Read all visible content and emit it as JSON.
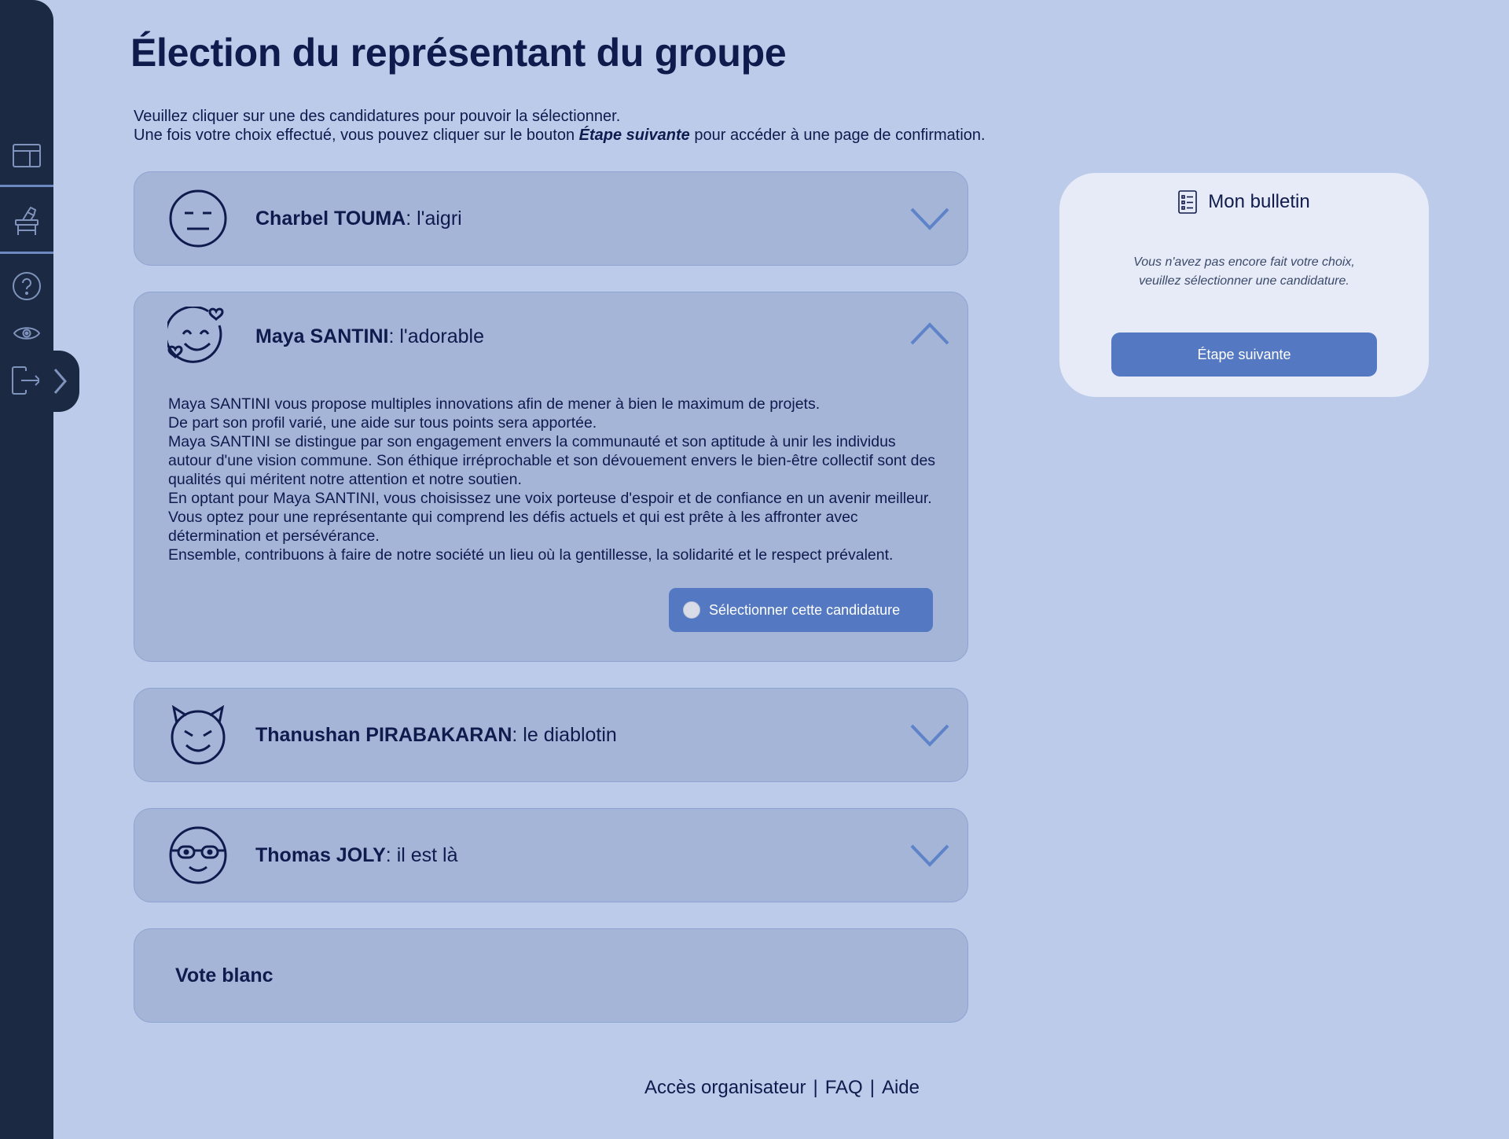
{
  "page": {
    "title": "Élection du représentant du groupe",
    "intro_line1": "Veuillez cliquer sur une des candidatures pour pouvoir la sélectionner.",
    "intro_line2_before": "Une fois votre choix effectué, vous pouvez cliquer sur le bouton ",
    "intro_line2_emphasis": "Étape suivante",
    "intro_line2_after": " pour accéder à une page de confirmation."
  },
  "sidebar": {
    "icons": [
      "layout-icon",
      "ballot-box-icon",
      "help-icon",
      "eye-icon",
      "logout-icon"
    ],
    "expand_icon": "chevron-right-icon"
  },
  "candidates": [
    {
      "name": "Charbel TOUMA",
      "tagline": " : l'aigri",
      "avatar": "neutral-face-icon",
      "expanded": false
    },
    {
      "name": "Maya SANTINI",
      "tagline": " : l'adorable",
      "avatar": "heart-smile-face-icon",
      "expanded": true,
      "description": [
        "Maya SANTINI vous propose multiples innovations afin de mener à bien le maximum de projets.",
        "De part son profil varié, une aide sur tous points sera apportée.",
        "Maya SANTINI se distingue par son engagement envers la communauté et son aptitude à unir les individus autour d'une vision commune. Son éthique irréprochable et son dévouement envers le bien-être collectif sont des qualités qui méritent notre attention et notre soutien.",
        "En optant pour Maya SANTINI, vous choisissez une voix porteuse d'espoir et de confiance en un avenir meilleur. Vous optez pour une représentante qui comprend les défis actuels et qui est prête à les affronter avec détermination et persévérance.",
        "Ensemble, contribuons à faire de notre société un lieu où la gentillesse, la solidarité et le respect prévalent."
      ],
      "select_label": "Sélectionner cette candidature"
    },
    {
      "name": "Thanushan PIRABAKARAN",
      "tagline": " : le diablotin",
      "avatar": "devil-face-icon",
      "expanded": false
    },
    {
      "name": "Thomas JOLY",
      "tagline": " : il est là",
      "avatar": "glasses-face-icon",
      "expanded": false
    }
  ],
  "blank_vote": {
    "label": "Vote blanc"
  },
  "ballot": {
    "title": "Mon bulletin",
    "icon": "list-icon",
    "message_line1": "Vous n'avez pas encore fait votre choix,",
    "message_line2": "veuillez sélectionner une candidature.",
    "next_label": "Étape suivante"
  },
  "footer": {
    "organizer": "Accès organisateur",
    "faq": "FAQ",
    "help": "Aide",
    "separator": "|"
  },
  "colors": {
    "background": "#bccbe9",
    "sidebar": "#1b2a42",
    "card": "#a5b5d8",
    "accent": "#5479c2",
    "text": "#0f1a4d"
  }
}
